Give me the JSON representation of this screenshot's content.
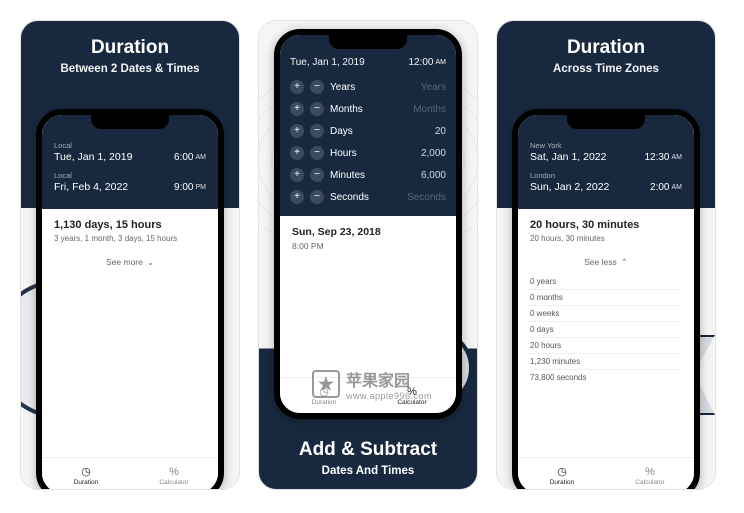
{
  "panels": {
    "p1": {
      "title": "Duration",
      "subtitle": "Between 2 Dates & Times",
      "rows": [
        {
          "label": "Local",
          "date": "Tue, Jan 1, 2019",
          "time": "6:00",
          "ampm": "AM"
        },
        {
          "label": "Local",
          "date": "Fri, Feb 4, 2022",
          "time": "9:00",
          "ampm": "PM"
        }
      ],
      "result_main": "1,130 days, 15 hours",
      "result_sub": "3 years, 1 month, 3 days, 15 hours",
      "see_more": "See more"
    },
    "p2": {
      "title": "Add & Subtract",
      "subtitle": "Dates And Times",
      "top_date": "Tue, Jan 1, 2019",
      "top_time": "12:00",
      "top_ampm": "AM",
      "units": [
        {
          "name": "Years",
          "value": "",
          "placeholder": "Years"
        },
        {
          "name": "Months",
          "value": "",
          "placeholder": "Months"
        },
        {
          "name": "Days",
          "value": "20",
          "placeholder": ""
        },
        {
          "name": "Hours",
          "value": "2,000",
          "placeholder": ""
        },
        {
          "name": "Minutes",
          "value": "6,000",
          "placeholder": ""
        },
        {
          "name": "Seconds",
          "value": "",
          "placeholder": "Seconds"
        }
      ],
      "result_date": "Sun, Sep 23, 2018",
      "result_time": "8:00 PM"
    },
    "p3": {
      "title": "Duration",
      "subtitle": "Across Time Zones",
      "rows": [
        {
          "label": "New York",
          "date": "Sat, Jan 1, 2022",
          "time": "12:30",
          "ampm": "AM"
        },
        {
          "label": "London",
          "date": "Sun, Jan 2, 2022",
          "time": "2:00",
          "ampm": "AM"
        }
      ],
      "result_main": "20 hours, 30 minutes",
      "result_sub": "20 hours, 30 minutes",
      "see_less": "See less",
      "details": [
        "0 years",
        "0 months",
        "0 weeks",
        "0 days",
        "20 hours",
        "1,230 minutes",
        "73,800 seconds"
      ]
    }
  },
  "nav": {
    "duration": "Duration",
    "calculator": "Calculator"
  },
  "watermark": {
    "text": "苹果家园",
    "url": "www.apple996.com"
  }
}
